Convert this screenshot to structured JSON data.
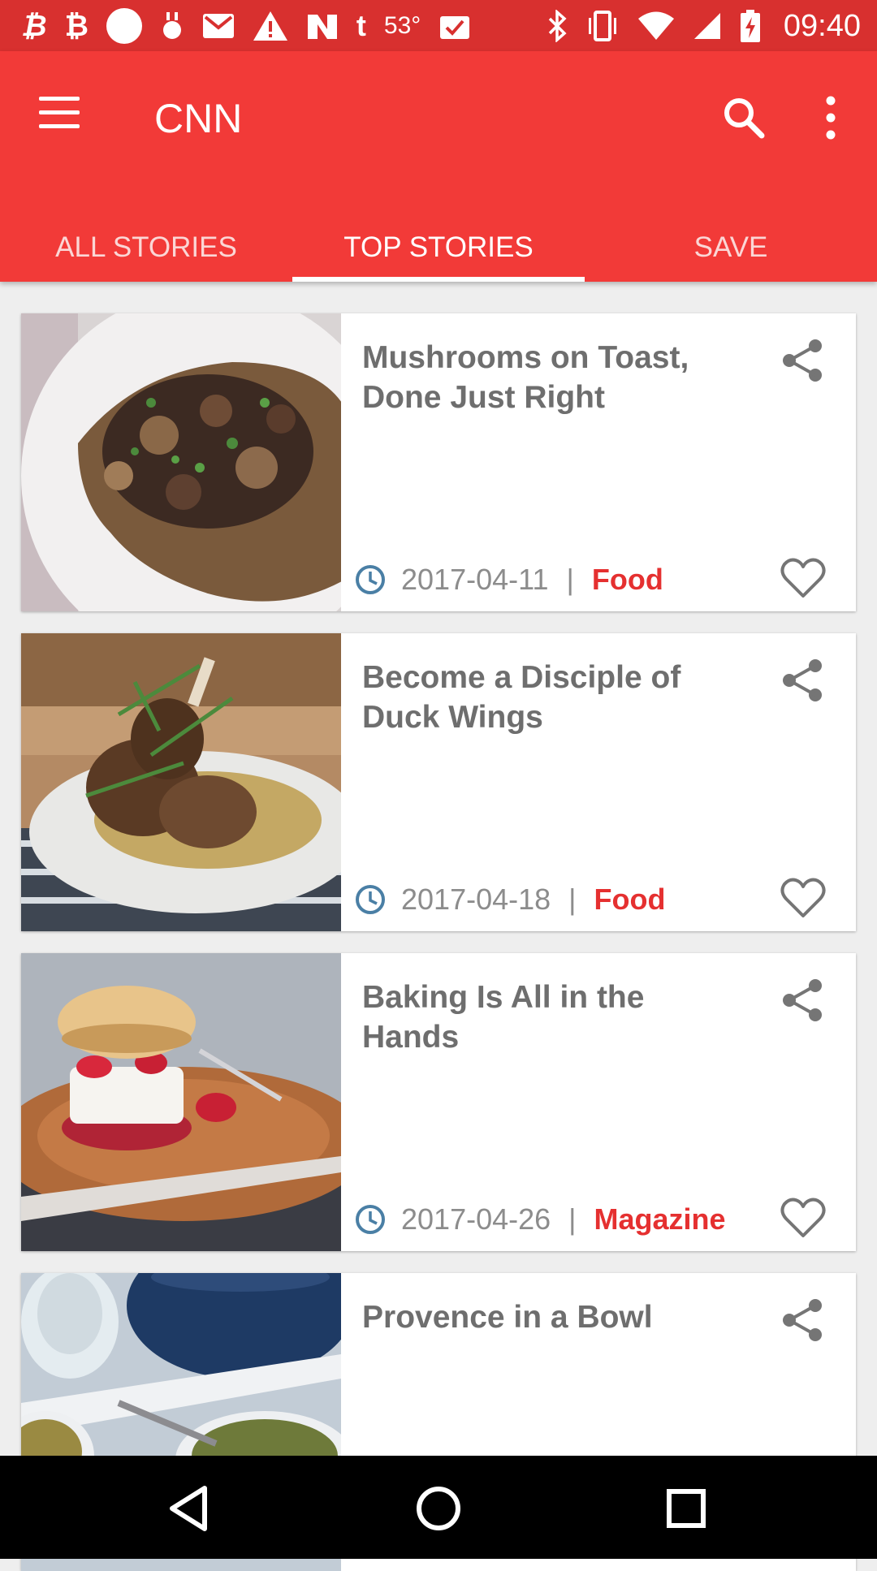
{
  "status_bar": {
    "left_icons": [
      "bitcoin-icon",
      "bitcoin-icon",
      "circle-icon",
      "notification-icon",
      "gmail-icon",
      "warning-icon",
      "news-icon",
      "tumblr-icon",
      "weather-icon",
      "task-icon"
    ],
    "temperature": "53°",
    "right_icons": [
      "bluetooth-icon",
      "vibrate-icon",
      "wifi-icon",
      "signal-icon",
      "battery-charging-icon"
    ],
    "time": "09:40"
  },
  "app_bar": {
    "title": "CNN",
    "color": "#f23a38",
    "tabs": [
      {
        "label": "ALL STORIES",
        "selected": false
      },
      {
        "label": "TOP STORIES",
        "selected": true
      },
      {
        "label": "SAVE",
        "selected": false
      }
    ]
  },
  "stories": [
    {
      "title": "Mushrooms on Toast, Done Just Right",
      "date": "2017-04-11",
      "separator": "|",
      "category": "Food",
      "image": "mushrooms-toast-photo"
    },
    {
      "title": "Become a Disciple of Duck Wings",
      "date": "2017-04-18",
      "separator": "|",
      "category": "Food",
      "image": "duck-wings-photo"
    },
    {
      "title": "Baking Is All in the Hands",
      "date": "2017-04-26",
      "separator": "|",
      "category": "Magazine",
      "image": "shortcake-photo"
    },
    {
      "title": "Provence in a Bowl",
      "image": "soup-bowl-photo"
    }
  ],
  "colors": {
    "category": "#e53030",
    "accent": "#f23a38",
    "clock_icon": "#4a7fa5"
  },
  "nav_bar": {
    "buttons": [
      "back-icon",
      "home-icon",
      "recents-icon"
    ]
  }
}
